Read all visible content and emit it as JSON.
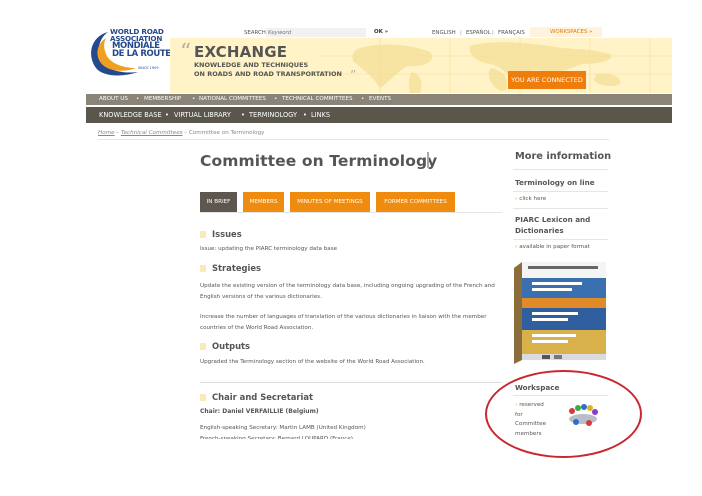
{
  "logo": {
    "line1": "WORLD ROAD",
    "line1b": "ASSOCIATION",
    "line2": "MONDIALE",
    "line2b": "DE LA ROUTE",
    "since": "SINCE 1909"
  },
  "topbar": {
    "search_label": "SEARCH",
    "search_placeholder": "Keyword",
    "ok": "OK »",
    "languages": [
      "ENGLISH",
      "ESPAÑOL",
      "FRANÇAIS"
    ],
    "workspaces": "WORKSPACES »"
  },
  "banner": {
    "quote_open": "“",
    "title": "EXCHANGE",
    "subtitle1": "KNOWLEDGE AND TECHNIQUES",
    "subtitle2": "ON ROADS AND ROAD TRANSPORTATION",
    "quote_close": "”",
    "connected": "YOU ARE CONNECTED"
  },
  "nav1": [
    "ABOUT US",
    "MEMBERSHIP",
    "NATIONAL COMMITTEES",
    "TECHNICAL COMMITTEES",
    "EVENTS"
  ],
  "nav2": [
    "KNOWLEDGE BASE",
    "VIRTUAL LIBRARY",
    "TERMINOLOGY",
    "LINKS"
  ],
  "breadcrumb": {
    "home": "Home",
    "sep1": " – ",
    "technical": "Technical Committees",
    "sep2": " – ",
    "current": "Committee on Terminology"
  },
  "main": {
    "title": "Committee on Terminology",
    "tabs": [
      "IN BRIEF",
      "MEMBERS",
      "MINUTES OF MEETINGS",
      "FORMER COMMITTEES"
    ],
    "issues_heading": "Issues",
    "issues_text": "Issue: updating the PIARC terminology data base",
    "strategies_heading": "Strategies",
    "strategies_text1": "Update the existing version of the terminology data base, including ongoing upgrading of the French and English versions of the various dictionaries.",
    "strategies_text2": "Increase the number of languages of translation of the various dictionaries in liaison with the member countries of the World Road Association.",
    "outputs_heading": "Outputs",
    "outputs_text": "Upgraded the Terminology section of the website of the World Road Association.",
    "chair_heading": "Chair and Secretariat",
    "chair": "Chair: Daniel VERFAILLIE (Belgium)",
    "english_secretary": "English-speaking Secretary: Martin LAMB (United Kingdom)",
    "french_secretary": "French-speaking Secretary: Bernard LOUPARD (France)"
  },
  "sidebar": {
    "more_info": "More information",
    "terminology_online": "Terminology on line",
    "click_here": "click here",
    "lexicon_heading": "PIARC Lexicon and Dictionaries",
    "paper_format": "available in paper format",
    "workspace_heading": "Workspace",
    "reserved1": "reserved",
    "reserved2": "for",
    "reserved3": "Committee",
    "reserved4": "members"
  },
  "colors": {
    "orange": "#ef8c0f",
    "nav_light": "#8a8378",
    "nav_dark": "#5b564c",
    "banner": "#fff3c7",
    "annotation_circle": "#c8282e"
  }
}
